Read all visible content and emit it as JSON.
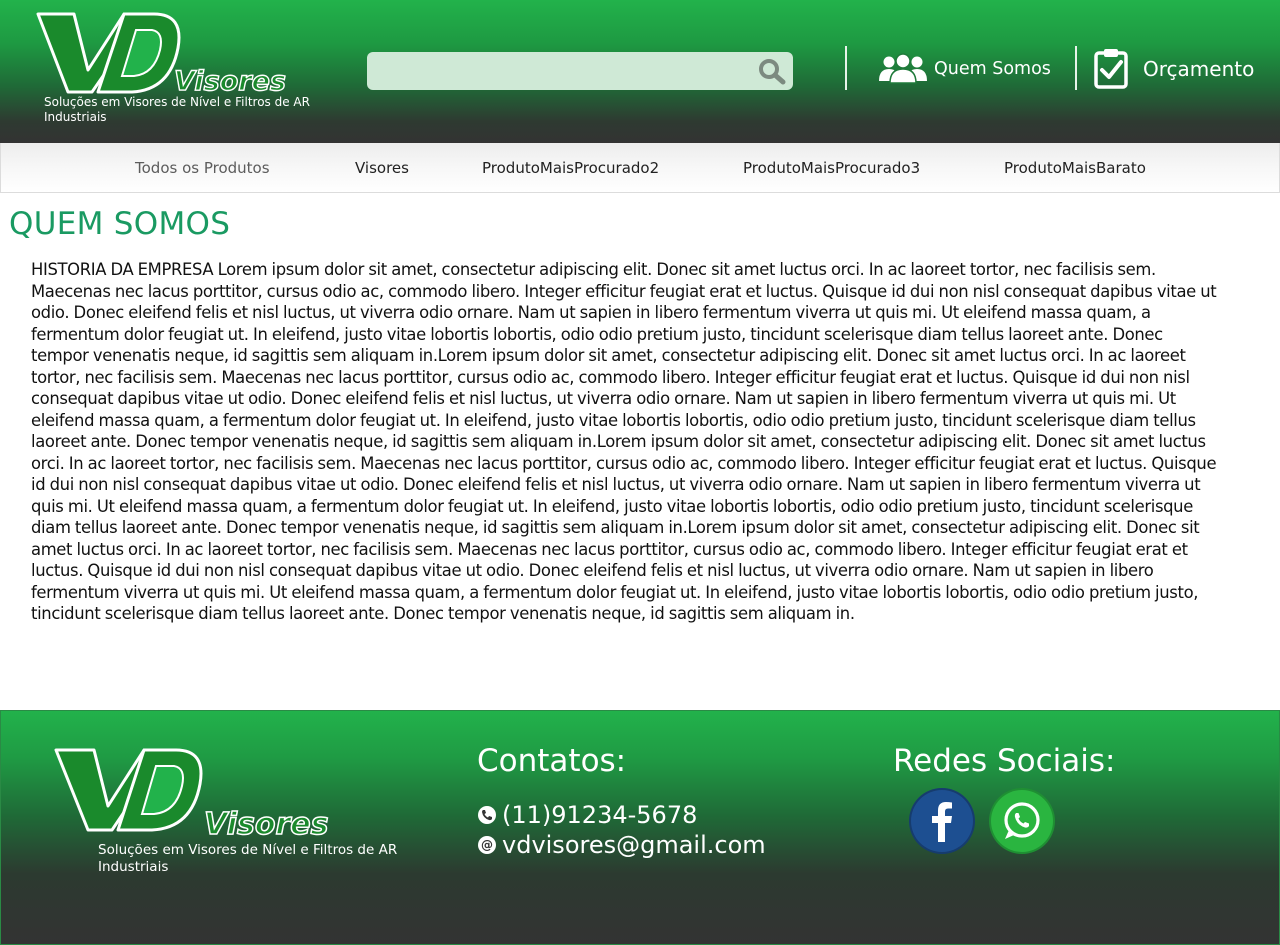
{
  "brand": {
    "logo_letters": "VD",
    "logo_word": "Visores",
    "tagline": "Soluções em Visores de Nível e Filtros de AR Industriais"
  },
  "header": {
    "search": {
      "placeholder": "",
      "value": ""
    },
    "nav": [
      {
        "label": "Quem Somos",
        "icon": "users-icon"
      },
      {
        "label": "Orçamento",
        "icon": "clipboard-check-icon"
      }
    ]
  },
  "menu": {
    "items": [
      {
        "label": "Todos os Produtos"
      },
      {
        "label": "Visores"
      },
      {
        "label": "ProdutoMaisProcurado2"
      },
      {
        "label": "ProdutoMaisProcurado3"
      },
      {
        "label": "ProdutoMaisBarato"
      }
    ]
  },
  "main": {
    "title": "QUEM SOMOS",
    "body": "HISTORIA DA EMPRESA Lorem ipsum dolor sit amet, consectetur adipiscing elit. Donec sit amet luctus orci. In ac laoreet tortor, nec facilisis sem. Maecenas nec lacus porttitor, cursus odio ac, commodo libero. Integer efficitur feugiat erat et luctus. Quisque id dui non nisl consequat dapibus vitae ut odio. Donec eleifend felis et nisl luctus, ut viverra odio ornare. Nam ut sapien in libero fermentum viverra ut quis mi. Ut eleifend massa quam, a fermentum dolor feugiat ut. In eleifend, justo vitae lobortis lobortis, odio odio pretium justo, tincidunt scelerisque diam tellus laoreet ante. Donec tempor venenatis neque, id sagittis sem aliquam in.Lorem ipsum dolor sit amet, consectetur adipiscing elit. Donec sit amet luctus orci. In ac laoreet tortor, nec facilisis sem. Maecenas nec lacus porttitor, cursus odio ac, commodo libero. Integer efficitur feugiat erat et luctus. Quisque id dui non nisl consequat dapibus vitae ut odio. Donec eleifend felis et nisl luctus, ut viverra odio ornare. Nam ut sapien in libero fermentum viverra ut quis mi. Ut eleifend massa quam, a fermentum dolor feugiat ut. In eleifend, justo vitae lobortis lobortis, odio odio pretium justo, tincidunt scelerisque diam tellus laoreet ante. Donec tempor venenatis neque, id sagittis sem aliquam in.Lorem ipsum dolor sit amet, consectetur adipiscing elit. Donec sit amet luctus orci. In ac laoreet tortor, nec facilisis sem. Maecenas nec lacus porttitor, cursus odio ac, commodo libero. Integer efficitur feugiat erat et luctus. Quisque id dui non nisl consequat dapibus vitae ut odio. Donec eleifend felis et nisl luctus, ut viverra odio ornare. Nam ut sapien in libero fermentum viverra ut quis mi. Ut eleifend massa quam, a fermentum dolor feugiat ut. In eleifend, justo vitae lobortis lobortis, odio odio pretium justo, tincidunt scelerisque diam tellus laoreet ante. Donec tempor venenatis neque, id sagittis sem aliquam in.Lorem ipsum dolor sit amet, consectetur adipiscing elit. Donec sit amet luctus orci. In ac laoreet tortor, nec facilisis sem. Maecenas nec lacus porttitor, cursus odio ac, commodo libero. Integer efficitur feugiat erat et luctus. Quisque id dui non nisl consequat dapibus vitae ut odio. Donec eleifend felis et nisl luctus, ut viverra odio ornare. Nam ut sapien in libero fermentum viverra ut quis mi. Ut eleifend massa quam, a fermentum dolor feugiat ut. In eleifend, justo vitae lobortis lobortis, odio odio pretium justo, tincidunt scelerisque diam tellus laoreet ante. Donec tempor venenatis neque, id sagittis sem aliquam in."
  },
  "footer": {
    "contacts_heading": "Contatos:",
    "phone": "(11)91234-5678",
    "email": "vdvisores@gmail.com",
    "social_heading": "Redes Sociais:",
    "social": [
      {
        "icon": "facebook-icon",
        "color": "#1d4f91"
      },
      {
        "icon": "whatsapp-icon",
        "color": "#2ab540"
      }
    ]
  },
  "colors": {
    "brand_green": "#22b24b",
    "title_green": "#1a9a62",
    "dark": "#333333",
    "search_bg": "#cfe9d6"
  }
}
